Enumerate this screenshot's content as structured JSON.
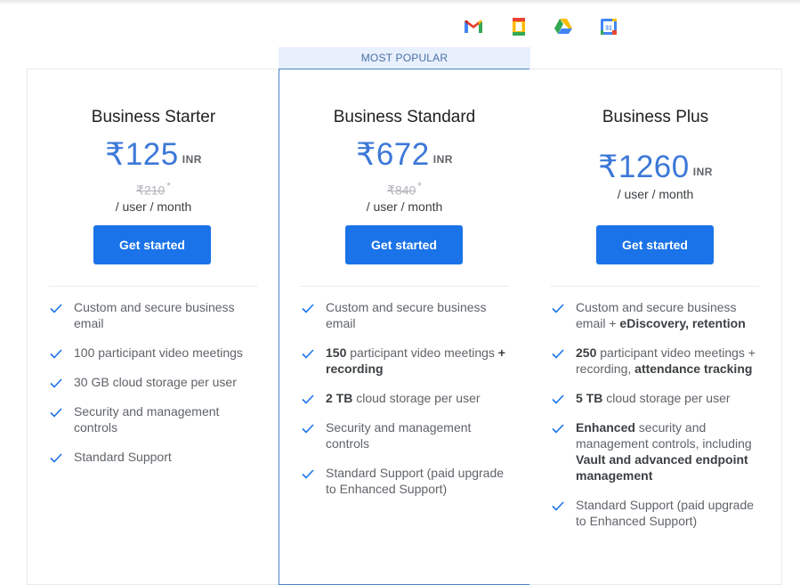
{
  "header": {
    "apps": [
      {
        "name": "gmail-icon"
      },
      {
        "name": "docs-icon"
      },
      {
        "name": "drive-icon"
      },
      {
        "name": "calendar-icon",
        "label": "31"
      }
    ]
  },
  "badge": "MOST POPULAR",
  "plans": [
    {
      "name": "Business Starter",
      "price": "₹125",
      "currency": "INR",
      "old_price": "₹210",
      "asterisk": "*",
      "period": "/ user / month",
      "cta": "Get started",
      "features": [
        [
          "Custom and secure business email"
        ],
        [
          "100 participant video meetings"
        ],
        [
          "30 GB cloud storage per user"
        ],
        [
          "Security and management controls"
        ],
        [
          "Standard Support"
        ]
      ]
    },
    {
      "name": "Business Standard",
      "price": "₹672",
      "currency": "INR",
      "old_price": "₹840",
      "asterisk": "*",
      "period": "/ user / month",
      "cta": "Get started",
      "features": [
        [
          "Custom and secure business email"
        ],
        [
          "150",
          " participant video meetings ",
          "+ recording"
        ],
        [
          "2 TB",
          " cloud storage per user"
        ],
        [
          "Security and management controls"
        ],
        [
          "Standard Support (paid upgrade to Enhanced Support)"
        ]
      ]
    },
    {
      "name": "Business Plus",
      "price": "₹1260",
      "currency": "INR",
      "period": "/ user / month",
      "cta": "Get started",
      "features": [
        [
          "Custom and secure business email + ",
          "eDiscovery, retention"
        ],
        [
          "250",
          " participant video meetings + recording, ",
          "attendance tracking"
        ],
        [
          "5 TB",
          " cloud storage per user"
        ],
        [
          "Enhanced",
          " security and management controls, including ",
          "Vault and advanced endpoint management"
        ],
        [
          "Standard Support (paid upgrade to Enhanced Support)"
        ]
      ]
    }
  ],
  "colors": {
    "accent": "#1a73e8",
    "price": "#3c78d8",
    "check": "#1a73e8",
    "popular_bg": "#e8f0fe",
    "popular_border": "#4a86c5"
  }
}
